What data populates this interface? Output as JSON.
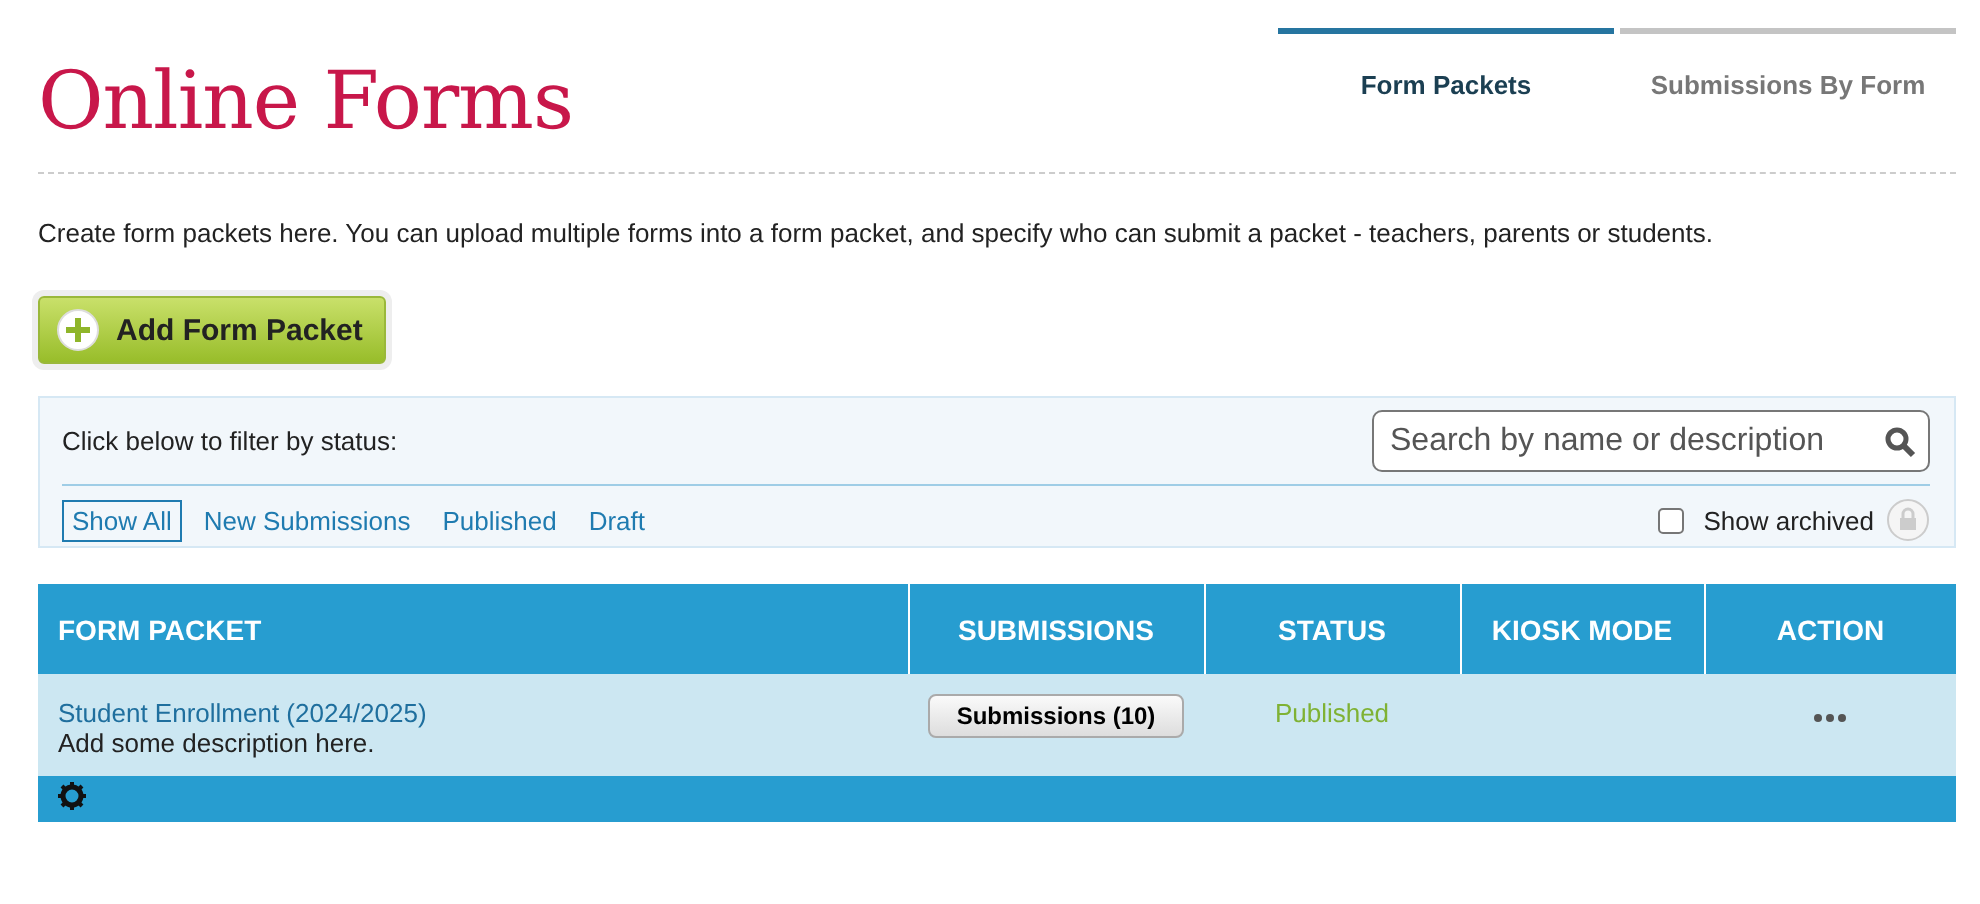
{
  "title": "Online Forms",
  "tabs": [
    {
      "label": "Form Packets",
      "selected": true
    },
    {
      "label": "Submissions By Form",
      "selected": false
    }
  ],
  "intro": "Create form packets here. You can upload multiple forms into a form packet, and specify who can submit a packet - teachers, parents or students.",
  "add_button": "Add Form Packet",
  "filter": {
    "label": "Click below to filter by status:",
    "search": {
      "placeholder": "Search by name or description"
    },
    "options": [
      {
        "label": "Show All",
        "selected": true
      },
      {
        "label": "New Submissions",
        "selected": false
      },
      {
        "label": "Published",
        "selected": false
      },
      {
        "label": "Draft",
        "selected": false
      }
    ],
    "show_archived": {
      "label": "Show archived",
      "checked": false
    }
  },
  "table": {
    "columns": [
      "FORM PACKET",
      "SUBMISSIONS",
      "STATUS",
      "KIOSK MODE",
      "ACTION"
    ],
    "rows": [
      {
        "name": "Student Enrollment (2024/2025)",
        "description": "Add some description here.",
        "submissions": "Submissions (10)",
        "status": "Published"
      }
    ]
  }
}
